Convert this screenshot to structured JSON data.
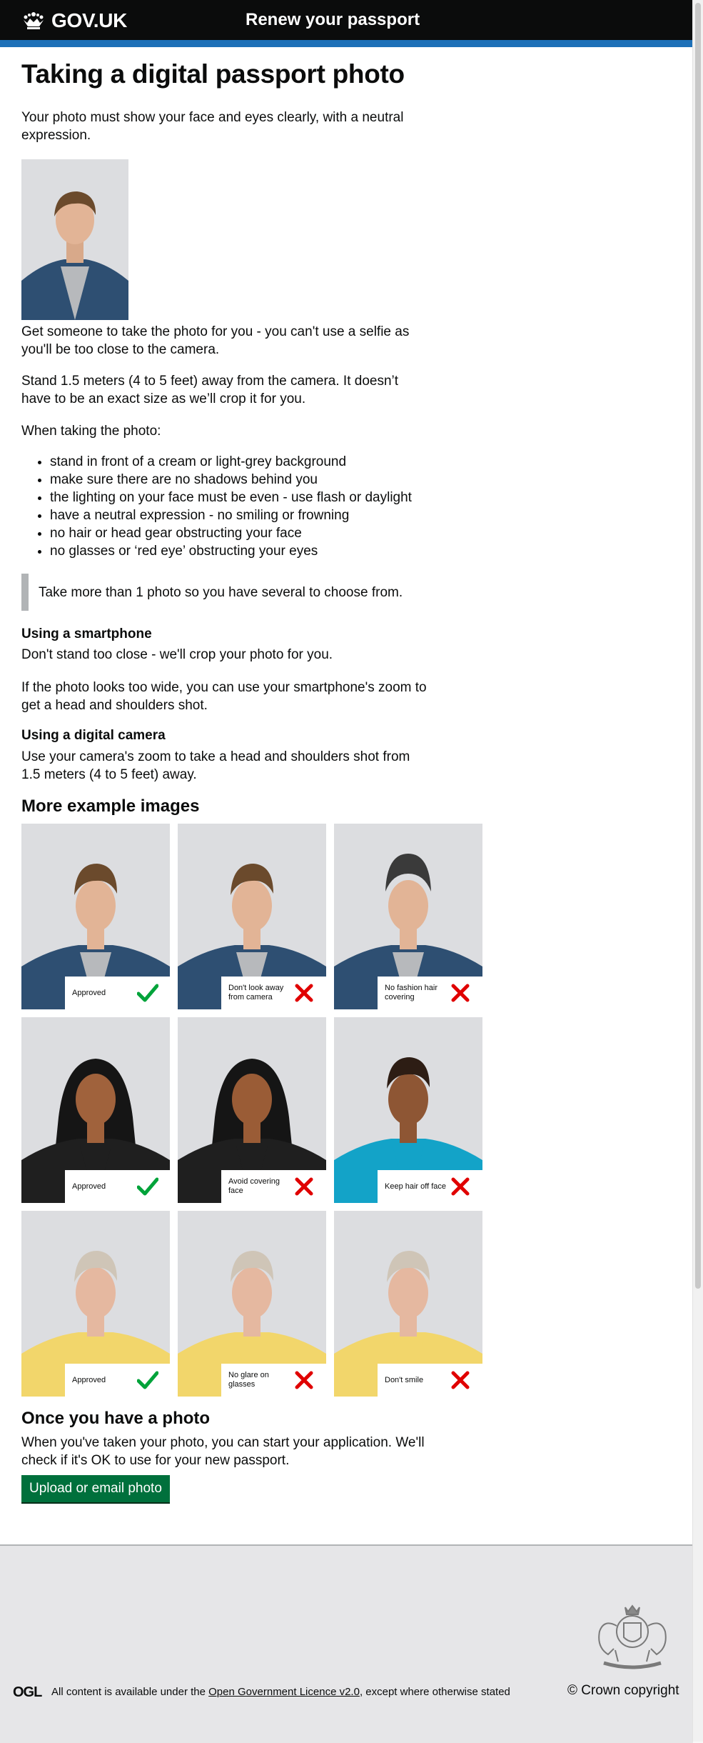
{
  "header": {
    "logo_text": "GOV.UK",
    "service_name": "Renew your passport"
  },
  "page": {
    "title": "Taking a digital passport photo",
    "intro": "Your photo must show your face and eyes clearly, with a neutral expression.",
    "para_selfie": "Get someone to take the photo for you - you can't use a selfie as you'll be too close to the camera.",
    "para_distance": "Stand 1.5 meters (4 to 5 feet) away from the camera. It doesn’t have to be an exact size as we’ll crop it for you.",
    "para_when": "When taking the photo:",
    "rules": [
      "stand in front of a cream or light-grey background",
      "make sure there are no shadows behind you",
      "the lighting on your face must be even - use flash or daylight",
      "have a neutral expression - no smiling or frowning",
      "no hair or head gear obstructing your face",
      "no glasses or ‘red eye’ obstructing your eyes"
    ],
    "inset": "Take more than 1 photo so you have several to choose from.",
    "smartphone_heading": "Using a smartphone",
    "smartphone_p1": "Don't stand too close - we'll crop your photo for you.",
    "smartphone_p2": "If the photo looks too wide, you can use your smartphone's zoom to get a head and shoulders shot.",
    "camera_heading": "Using a digital camera",
    "camera_p1": "Use your camera's zoom to take a head and shoulders shot from 1.5 meters (4 to 5 feet) away.",
    "examples_heading": "More example images",
    "examples": [
      {
        "caption": "Approved",
        "status": "approved"
      },
      {
        "caption": "Don't look away from camera",
        "status": "rejected"
      },
      {
        "caption": "No fashion hair covering",
        "status": "rejected"
      },
      {
        "caption": "Approved",
        "status": "approved"
      },
      {
        "caption": "Avoid covering face",
        "status": "rejected"
      },
      {
        "caption": "Keep hair off face",
        "status": "rejected"
      },
      {
        "caption": "Approved",
        "status": "approved"
      },
      {
        "caption": "No glare on glasses",
        "status": "rejected"
      },
      {
        "caption": "Don't smile",
        "status": "rejected"
      }
    ],
    "once_heading": "Once you have a photo",
    "once_p": "When you've taken your photo, you can start your application. We'll check if it's OK to use for your new passport.",
    "button_label": "Upload or email photo"
  },
  "footer": {
    "ogl": "OGL",
    "licence_prefix": "All content is available under the ",
    "licence_link": "Open Government Licence v2.0",
    "licence_suffix": ", except where otherwise stated",
    "copyright": "© Crown copyright"
  },
  "colors": {
    "header": "#0b0c0c",
    "brand_blue": "#1d70b8",
    "button_green": "#00703c",
    "approved_green": "#00a33a",
    "rejected_red": "#e00000"
  }
}
